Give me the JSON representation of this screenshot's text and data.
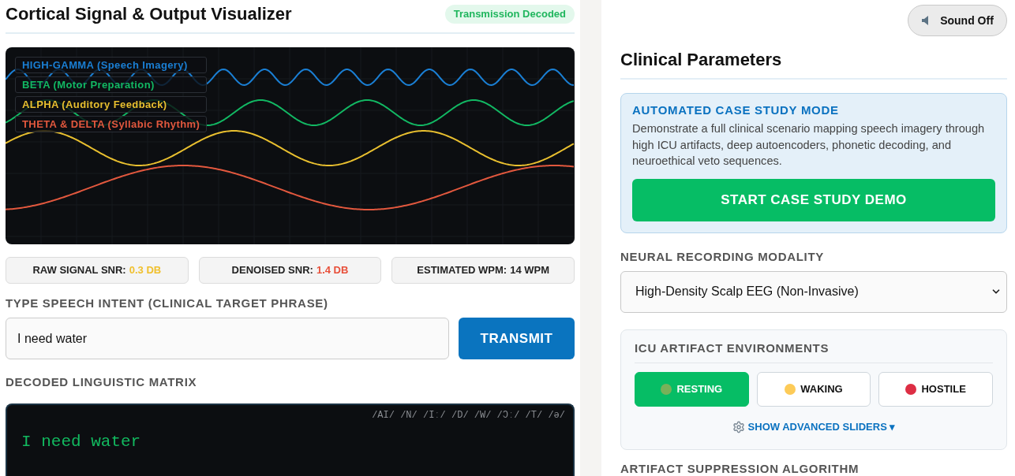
{
  "visualizer": {
    "title": "Cortical Signal & Output Visualizer",
    "status_badge": "Transmission Decoded",
    "bands": [
      {
        "label": "HIGH-GAMMA (Speech Imagery)",
        "color": "#1a7fd4"
      },
      {
        "label": "BETA (Motor Preparation)",
        "color": "#12b863"
      },
      {
        "label": "ALPHA (Auditory Feedback)",
        "color": "#e8bf2f"
      },
      {
        "label": "THETA & DELTA (Syllabic Rhythm)",
        "color": "#e2583e"
      }
    ],
    "stats": [
      {
        "label": "RAW SIGNAL SNR:",
        "value": "0.3 DB",
        "color": "#f0c02e"
      },
      {
        "label": "DENOISED SNR:",
        "value": "1.4 DB",
        "color": "#e8503a"
      },
      {
        "label": "ESTIMATED WPM:",
        "value": "14 WPM",
        "color": "#222222"
      }
    ],
    "intent": {
      "label": "TYPE SPEECH INTENT (CLINICAL TARGET PHRASE)",
      "value": "I need water",
      "button": "TRANSMIT"
    },
    "decoded": {
      "label": "DECODED LINGUISTIC MATRIX",
      "phonemes": "/AI/ /N/ /Iː/ /D/ /W/ /Ɔː/ /T/ /ə/",
      "text": "I need water"
    }
  },
  "controls": {
    "sound_button": "Sound Off",
    "title": "Clinical Parameters",
    "case_study": {
      "title": "AUTOMATED CASE STUDY MODE",
      "description": "Demonstrate a full clinical scenario mapping speech imagery through high ICU artifacts, deep autoencoders, phonetic decoding, and neuroethical veto sequences.",
      "button": "START CASE STUDY DEMO"
    },
    "modality": {
      "label": "NEURAL RECORDING MODALITY",
      "value": "High-Density Scalp EEG (Non-Invasive)"
    },
    "environments": {
      "title": "ICU ARTIFACT ENVIRONMENTS",
      "options": [
        {
          "label": "RESTING",
          "selected": true,
          "color": "#78b159"
        },
        {
          "label": "WAKING",
          "selected": false,
          "color": "#fdcb58"
        },
        {
          "label": "HOSTILE",
          "selected": false,
          "color": "#dd2e44"
        }
      ],
      "advanced_toggle": "SHOW ADVANCED SLIDERS ▾"
    },
    "next_section": "ARTIFACT SUPPRESSION ALGORITHM"
  }
}
